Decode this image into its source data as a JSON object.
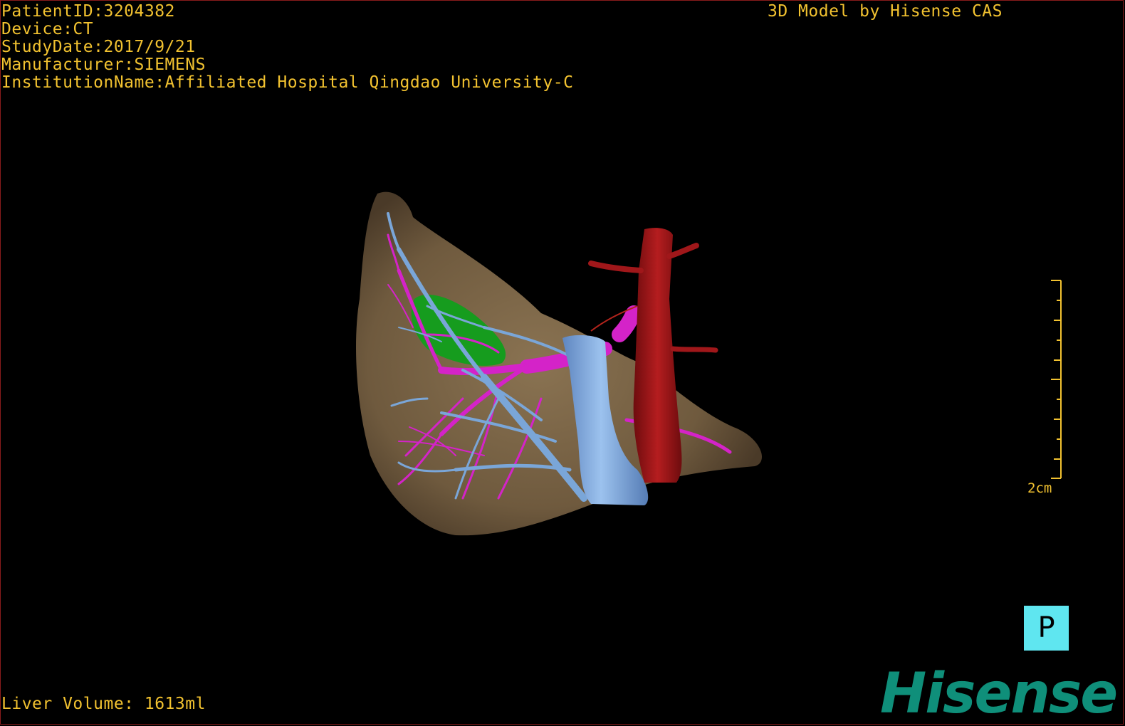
{
  "overlay": {
    "patient_id": "PatientID:3204382",
    "device": "Device:CT",
    "study_date": "StudyDate:2017/9/21",
    "manufacturer": "Manufacturer:SIEMENS",
    "institution": "InstitutionName:Affiliated Hospital Qingdao University-C",
    "model_credit": "3D Model by Hisense CAS",
    "liver_volume": "Liver Volume: 1613ml"
  },
  "scale_bar": {
    "label": "2cm"
  },
  "orientation": {
    "label": "P"
  },
  "brand": {
    "logo_text": "Hisense"
  },
  "colors": {
    "overlay_text": "#f2c230",
    "liver": "#7d6649",
    "hepatic_vein": "#7aa6d8",
    "portal_vein": "#d423c8",
    "aorta": "#a0171a",
    "gallbladder": "#169c1e",
    "orientation_cube": "#5fe6f0",
    "logo": "#0f8f7a"
  }
}
